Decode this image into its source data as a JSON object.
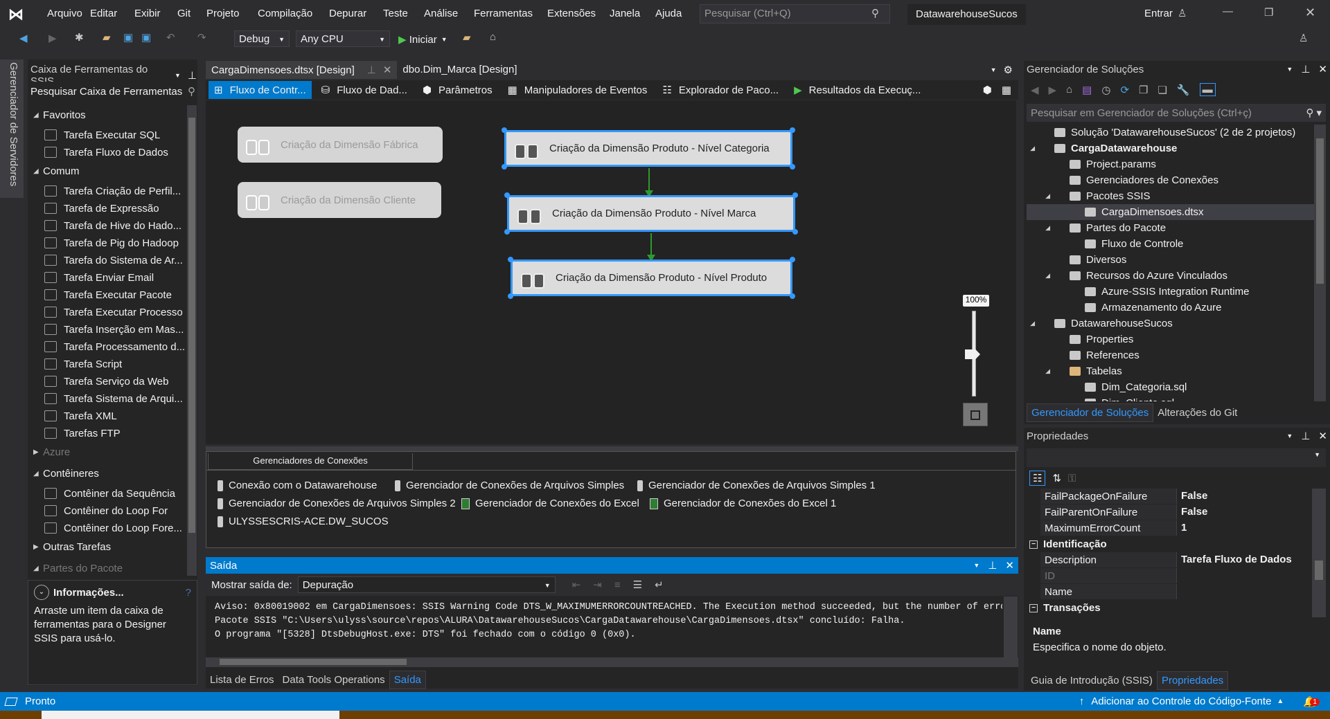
{
  "menubar": {
    "items": [
      "Arquivo",
      "Editar",
      "Exibir",
      "Git",
      "Projeto",
      "Compilação",
      "Depurar",
      "Teste",
      "Análise",
      "Ferramentas",
      "Extensões",
      "Janela",
      "Ajuda"
    ],
    "search_placeholder": "Pesquisar (Ctrl+Q)",
    "solution_name": "DatawarehouseSucos",
    "signin": "Entrar"
  },
  "toolbar": {
    "config": "Debug",
    "platform": "Any CPU",
    "start": "Iniciar"
  },
  "server_explorer_label": "Gerenciador de Servidores",
  "toolbox": {
    "title": "Caixa de Ferramentas do SSIS",
    "search_placeholder": "Pesquisar Caixa de Ferramentas",
    "groups": [
      {
        "label": "Favoritos",
        "expanded": true,
        "items": [
          "Tarefa Executar SQL",
          "Tarefa Fluxo de Dados"
        ]
      },
      {
        "label": "Comum",
        "expanded": true,
        "items": [
          "Tarefa Criação de Perfil...",
          "Tarefa de Expressão",
          "Tarefa de Hive do Hado...",
          "Tarefa de Pig do Hadoop",
          "Tarefa do Sistema de Ar...",
          "Tarefa Enviar Email",
          "Tarefa Executar Pacote",
          "Tarefa Executar Processo",
          "Tarefa Inserção em Mas...",
          "Tarefa Processamento d...",
          "Tarefa Script",
          "Tarefa Serviço da Web",
          "Tarefa Sistema de Arqui...",
          "Tarefa XML",
          "Tarefas FTP"
        ]
      },
      {
        "label": "Azure",
        "expanded": false,
        "disabled": true,
        "items": []
      },
      {
        "label": "Contêineres",
        "expanded": true,
        "items": [
          "Contêiner da Sequência",
          "Contêiner do Loop For",
          "Contêiner do Loop Fore..."
        ]
      },
      {
        "label": "Outras Tarefas",
        "expanded": false,
        "items": []
      },
      {
        "label": "Partes do Pacote",
        "expanded": true,
        "disabled": true,
        "items": []
      }
    ],
    "info_title": "Informações...",
    "info_text": "Arraste um item da caixa de ferramentas para o Designer SSIS para usá-lo."
  },
  "doc_tabs": [
    {
      "label": "CargaDimensoes.dtsx [Design]",
      "active": true
    },
    {
      "label": "dbo.Dim_Marca [Design]",
      "active": false
    }
  ],
  "designer_tabs": [
    "Fluxo de Contr...",
    "Fluxo de Dad...",
    "Parâmetros",
    "Manipuladores de Eventos",
    "Explorador de Paco...",
    "Resultados da Execuç..."
  ],
  "canvas": {
    "tasks": [
      {
        "label": "Criação da Dimensão Fábrica",
        "disabled": true
      },
      {
        "label": "Criação da Dimensão Cliente",
        "disabled": true
      },
      {
        "label": "Criação da Dimensão Produto - Nível Categoria",
        "selected": true
      },
      {
        "label": "Criação da Dimensão Produto - Nível Marca",
        "selected": true
      },
      {
        "label": "Criação da Dimensão Produto - Nível Produto",
        "selected": true
      }
    ],
    "zoom": "100%",
    "precedence_color": "#2e9a2e",
    "selection_color": "#3399ff"
  },
  "connections": {
    "tab": "Gerenciadores de Conexões",
    "items": [
      {
        "label": "Conexão com o Datawarehouse",
        "type": "db"
      },
      {
        "label": "Gerenciador de Conexões de Arquivos Simples",
        "type": "file"
      },
      {
        "label": "Gerenciador de Conexões de Arquivos Simples 1",
        "type": "file"
      },
      {
        "label": "Gerenciador de Conexões de Arquivos Simples 2",
        "type": "file"
      },
      {
        "label": "Gerenciador de Conexões do Excel",
        "type": "excel"
      },
      {
        "label": "Gerenciador de Conexões do Excel 1",
        "type": "excel"
      },
      {
        "label": "ULYSSESCRIS-ACE.DW_SUCOS",
        "type": "db"
      }
    ]
  },
  "output": {
    "title": "Saída",
    "show_from_label": "Mostrar saída de:",
    "show_from": "Depuração",
    "lines": [
      "Aviso: 0x80019002 em CargaDimensoes: SSIS Warning Code DTS_W_MAXIMUMERRORCOUNTREACHED.  The Execution method succeeded, but the number of erro",
      "Pacote SSIS \"C:\\Users\\ulyss\\source\\repos\\ALURA\\DatawarehouseSucos\\CargaDatawarehouse\\CargaDimensoes.dtsx\" concluído: Falha.",
      "O programa \"[5328] DtsDebugHost.exe: DTS\" foi fechado com o código 0 (0x0)."
    ],
    "bottom_tabs": [
      "Lista de Erros",
      "Data Tools Operations",
      "Saída"
    ]
  },
  "solution_explorer": {
    "title": "Gerenciador de Soluções",
    "search_placeholder": "Pesquisar em Gerenciador de Soluções (Ctrl+ç)",
    "tree": [
      {
        "label": "Solução 'DatawarehouseSucos' (2 de 2 projetos)",
        "level": 0,
        "expander": ""
      },
      {
        "label": "CargaDatawarehouse",
        "level": 0,
        "expander": "open",
        "bold": true
      },
      {
        "label": "Project.params",
        "level": 1,
        "expander": ""
      },
      {
        "label": "Gerenciadores de Conexões",
        "level": 1,
        "expander": ""
      },
      {
        "label": "Pacotes SSIS",
        "level": 1,
        "expander": "open"
      },
      {
        "label": "CargaDimensoes.dtsx",
        "level": 2,
        "expander": "",
        "selected": true
      },
      {
        "label": "Partes do Pacote",
        "level": 1,
        "expander": "open"
      },
      {
        "label": "Fluxo de Controle",
        "level": 2,
        "expander": ""
      },
      {
        "label": "Diversos",
        "level": 1,
        "expander": ""
      },
      {
        "label": "Recursos do Azure Vinculados",
        "level": 1,
        "expander": "open"
      },
      {
        "label": "Azure-SSIS Integration Runtime",
        "level": 2,
        "expander": ""
      },
      {
        "label": "Armazenamento do Azure",
        "level": 2,
        "expander": ""
      },
      {
        "label": "DatawarehouseSucos",
        "level": 0,
        "expander": "open"
      },
      {
        "label": "Properties",
        "level": 1,
        "expander": ""
      },
      {
        "label": "References",
        "level": 1,
        "expander": ""
      },
      {
        "label": "Tabelas",
        "level": 1,
        "expander": "open"
      },
      {
        "label": "Dim_Categoria.sql",
        "level": 2,
        "expander": ""
      },
      {
        "label": "Dim_Cliente.sql",
        "level": 2,
        "expander": ""
      }
    ],
    "tabs": [
      "Gerenciador de Soluções",
      "Alterações do Git"
    ]
  },
  "properties": {
    "title": "Propriedades",
    "rows": [
      {
        "name": "FailPackageOnFailure",
        "value": "False"
      },
      {
        "name": "FailParentOnFailure",
        "value": "False"
      },
      {
        "name": "MaximumErrorCount",
        "value": "1"
      },
      {
        "category": "Identificação"
      },
      {
        "name": "Description",
        "value": "Tarefa Fluxo de Dados"
      },
      {
        "name": "ID",
        "value": "",
        "disabled": true
      },
      {
        "name": "Name",
        "value": ""
      },
      {
        "category": "Transações"
      }
    ],
    "desc_title": "Name",
    "desc_text": "Especifica o nome do objeto.",
    "tabs": [
      "Guia de Introdução (SSIS)",
      "Propriedades"
    ]
  },
  "status": {
    "text": "Pronto",
    "source_control": "Adicionar ao Controle do Código-Fonte",
    "notifications": "1"
  }
}
